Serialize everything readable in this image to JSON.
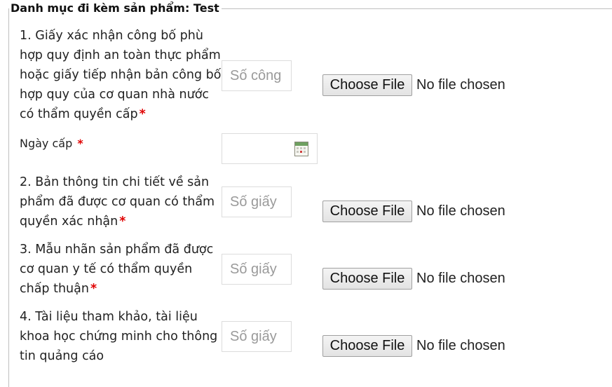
{
  "legend": "Danh mục đi kèm sản phẩm: Test",
  "required_mark": "*",
  "rows": [
    {
      "label": "1. Giấy xác nhận công bố phù hợp quy định an toàn thực phẩm hoặc giấy tiếp nhận bản công bố hợp quy của cơ quan nhà nước có thẩm quyền cấp",
      "input_placeholder": "Số công",
      "choose_label": "Choose File",
      "file_status": "No file chosen"
    },
    {
      "label": "2. Bản thông tin chi tiết về sản phẩm đã được cơ quan có thẩm quyền xác nhận",
      "input_placeholder": "Số giấy",
      "choose_label": "Choose File",
      "file_status": "No file chosen"
    },
    {
      "label": "3. Mẫu nhãn sản phẩm đã được cơ quan y tế có thẩm quyền chấp thuận",
      "input_placeholder": "Số giấy",
      "choose_label": "Choose File",
      "file_status": "No file chosen"
    },
    {
      "label": "4. Tài liệu tham khảo, tài liệu khoa học chứng minh cho thông tin quảng cáo",
      "input_placeholder": "Số giấy",
      "choose_label": "Choose File",
      "file_status": "No file chosen"
    }
  ],
  "date_field": {
    "label": "Ngày cấp",
    "icon": "calendar-icon"
  }
}
